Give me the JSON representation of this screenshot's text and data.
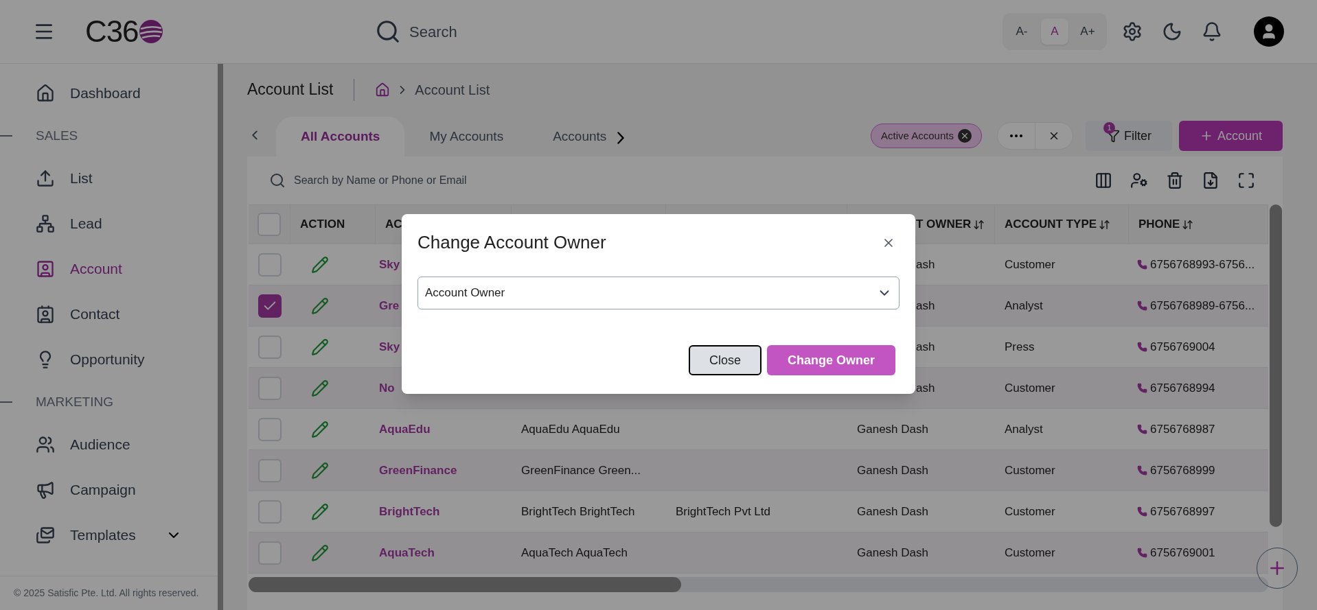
{
  "header": {
    "logo": "C36",
    "search_placeholder": "Search",
    "font_sizes": [
      {
        "label": "A-",
        "selected": false
      },
      {
        "label": "A",
        "selected": true
      },
      {
        "label": "A+",
        "selected": false
      }
    ]
  },
  "sidebar": {
    "items": [
      {
        "kind": "item",
        "label": "Dashboard",
        "selected": false
      },
      {
        "kind": "section",
        "label": "SALES"
      },
      {
        "kind": "item",
        "label": "List",
        "selected": false
      },
      {
        "kind": "item",
        "label": "Lead",
        "selected": false
      },
      {
        "kind": "item",
        "label": "Account",
        "selected": true
      },
      {
        "kind": "item",
        "label": "Contact",
        "selected": false
      },
      {
        "kind": "item",
        "label": "Opportunity",
        "selected": false
      },
      {
        "kind": "section",
        "label": "MARKETING"
      },
      {
        "kind": "item",
        "label": "Audience",
        "selected": false
      },
      {
        "kind": "item",
        "label": "Campaign",
        "selected": false
      },
      {
        "kind": "item",
        "label": "Templates",
        "selected": false,
        "expanded": false
      }
    ],
    "footer": "© 2025 Satisfic Pte. Ltd. All rights reserved."
  },
  "page": {
    "title": "Account List",
    "breadcrumb": "Account List"
  },
  "tabs": [
    {
      "label": "All Accounts",
      "selected": true
    },
    {
      "label": "My Accounts",
      "selected": false
    },
    {
      "label": "Accounts",
      "selected": false
    }
  ],
  "active_filter": "Active Accounts",
  "filter_button": {
    "label": "Filter",
    "badge": "1"
  },
  "add_button": "Account",
  "table": {
    "search_placeholder": "Search by Name or Phone or Email",
    "select_all_checked": false,
    "columns": [
      {
        "label": "ACTION",
        "sortable": false
      },
      {
        "label": "AC"
      },
      {},
      {},
      {
        "label": "T OWNER",
        "sortable": true,
        "partial": true
      },
      {
        "label": "ACCOUNT TYPE",
        "sortable": true
      },
      {
        "label": "PHONE",
        "sortable": true
      }
    ],
    "rows": [
      {
        "checked": false,
        "partial": true,
        "name": "Sky",
        "owner": "ash",
        "type": "Customer",
        "phone": "6756768993-6756..."
      },
      {
        "checked": true,
        "partial": true,
        "name": "Gre",
        "owner": "ash",
        "type": "Analyst",
        "phone": "6756768989-6756..."
      },
      {
        "checked": false,
        "partial": true,
        "name": "Sky",
        "owner": "ash",
        "type": "Press",
        "phone": "6756769004"
      },
      {
        "checked": false,
        "partial": true,
        "name": "No",
        "owner": "ash",
        "type": "Customer",
        "phone": "6756768994"
      },
      {
        "checked": false,
        "partial": false,
        "name": "AquaEdu",
        "full_name": "AquaEdu AquaEdu",
        "owner": "Ganesh Dash",
        "type": "Analyst",
        "phone": "6756768987"
      },
      {
        "checked": false,
        "partial": false,
        "name": "GreenFinance",
        "full_name": "GreenFinance Green...",
        "owner": "Ganesh Dash",
        "type": "Customer",
        "phone": "6756768999"
      },
      {
        "checked": false,
        "partial": false,
        "name": "BrightTech",
        "full_name": "BrightTech BrightTech",
        "company": "BrightTech Pvt Ltd",
        "owner": "Ganesh Dash",
        "type": "Customer",
        "phone": "6756768997"
      },
      {
        "checked": false,
        "partial": false,
        "name": "AquaTech",
        "full_name": "AquaTech AquaTech",
        "owner": "Ganesh Dash",
        "type": "Customer",
        "phone": "6756769001"
      }
    ]
  },
  "dialog": {
    "title": "Change Account Owner",
    "select_value": "Account Owner",
    "buttons": [
      {
        "kind": "secondary",
        "label": "Close"
      },
      {
        "kind": "primary",
        "label": "Change Owner"
      }
    ]
  }
}
